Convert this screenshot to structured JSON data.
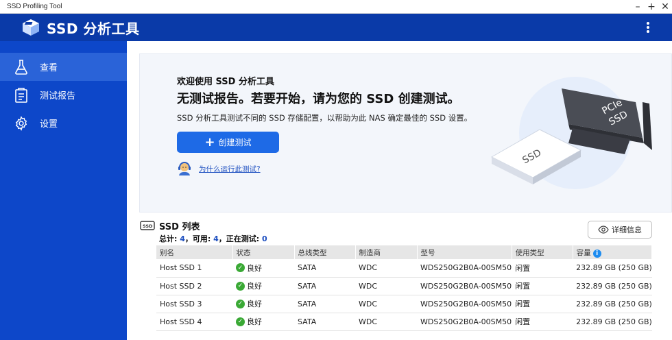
{
  "window": {
    "title": "SSD Profiling Tool",
    "controls": [
      "–",
      "+",
      "✕"
    ]
  },
  "app": {
    "title": "SSD 分析工具"
  },
  "sidebar": {
    "items": [
      {
        "label": "查看",
        "icon": "flask-icon",
        "active": true
      },
      {
        "label": "测试报告",
        "icon": "report-icon",
        "active": false
      },
      {
        "label": "设置",
        "icon": "gear-icon",
        "active": false
      }
    ]
  },
  "banner": {
    "welcome": "欢迎使用 SSD 分析工具",
    "headline": "无测试报告。若要开始，请为您的 SSD 创建测试。",
    "description": "SSD 分析工具测试不同的 SSD 存储配置，以帮助为此 NAS 确定最佳的 SSD 设置。",
    "create_button": "创建测试",
    "help_link": "为什么运行此测试?",
    "illustration_labels": {
      "ssd": "SSD",
      "pcie_line1": "PCIe",
      "pcie_line2": "SSD"
    }
  },
  "list": {
    "title": "SSD 列表",
    "stats": {
      "total_label": "总计: ",
      "total": "4",
      "available_label": "，可用: ",
      "available": "4",
      "testing_label": "，正在测试: ",
      "testing": "0"
    },
    "details_button": "详细信息",
    "columns": [
      "别名",
      "状态",
      "总线类型",
      "制造商",
      "型号",
      "使用类型",
      "容量"
    ],
    "rows": [
      {
        "alias": "Host SSD 1",
        "status": "良好",
        "bus": "SATA",
        "maker": "WDC",
        "model": "WDS250G2B0A-00SM50",
        "usage": "闲置",
        "capacity": "232.89 GB (250 GB)"
      },
      {
        "alias": "Host SSD 2",
        "status": "良好",
        "bus": "SATA",
        "maker": "WDC",
        "model": "WDS250G2B0A-00SM50",
        "usage": "闲置",
        "capacity": "232.89 GB (250 GB)"
      },
      {
        "alias": "Host SSD 3",
        "status": "良好",
        "bus": "SATA",
        "maker": "WDC",
        "model": "WDS250G2B0A-00SM50",
        "usage": "闲置",
        "capacity": "232.89 GB (250 GB)"
      },
      {
        "alias": "Host SSD 4",
        "status": "良好",
        "bus": "SATA",
        "maker": "WDC",
        "model": "WDS250G2B0A-00SM50",
        "usage": "闲置",
        "capacity": "232.89 GB (250 GB)"
      }
    ]
  },
  "colors": {
    "header": "#0a3aa8",
    "sidebar": "#0d47c9",
    "sidebar_active": "#2a63d8",
    "primary_button": "#1e6ae6",
    "status_ok": "#3aa935"
  }
}
